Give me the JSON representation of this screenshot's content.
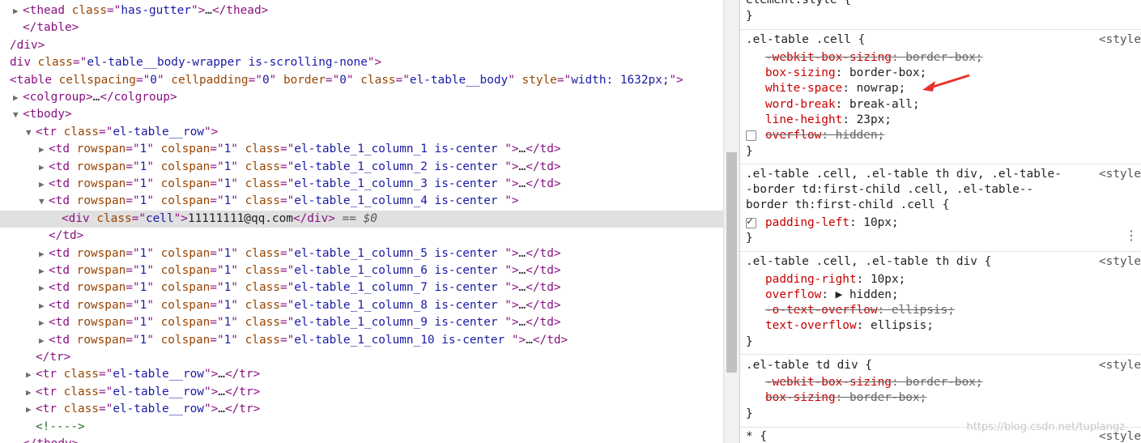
{
  "dom": {
    "lines": [
      {
        "indent": 1,
        "tri": "▶",
        "parts": [
          [
            "tag",
            "<"
          ],
          [
            "tag",
            "thead"
          ],
          [
            "tx",
            " "
          ],
          [
            "an",
            "class"
          ],
          [
            "tag",
            "=\""
          ],
          [
            "av",
            "has-gutter"
          ],
          [
            "tag",
            "\">"
          ],
          [
            "tx",
            "…"
          ],
          [
            "tag",
            "</thead>"
          ]
        ]
      },
      {
        "indent": 1,
        "tri": "",
        "parts": [
          [
            "tag",
            "</table>"
          ]
        ]
      },
      {
        "indent": 0,
        "tri": "",
        "parts": [
          [
            "tag",
            "/div>"
          ]
        ]
      },
      {
        "indent": 0,
        "tri": "",
        "parts": [
          [
            "tag",
            "div "
          ],
          [
            "an",
            "class"
          ],
          [
            "tag",
            "=\""
          ],
          [
            "av",
            "el-table__body-wrapper is-scrolling-none"
          ],
          [
            "tag",
            "\">"
          ]
        ]
      },
      {
        "indent": 0,
        "tri": "",
        "parts": [
          [
            "tag",
            "<table "
          ],
          [
            "an",
            "cellspacing"
          ],
          [
            "tag",
            "=\""
          ],
          [
            "av",
            "0"
          ],
          [
            "tag",
            "\" "
          ],
          [
            "an",
            "cellpadding"
          ],
          [
            "tag",
            "=\""
          ],
          [
            "av",
            "0"
          ],
          [
            "tag",
            "\" "
          ],
          [
            "an",
            "border"
          ],
          [
            "tag",
            "=\""
          ],
          [
            "av",
            "0"
          ],
          [
            "tag",
            "\" "
          ],
          [
            "an",
            "class"
          ],
          [
            "tag",
            "=\""
          ],
          [
            "av",
            "el-table__body"
          ],
          [
            "tag",
            "\" "
          ],
          [
            "an",
            "style"
          ],
          [
            "tag",
            "=\""
          ],
          [
            "av",
            "width: 1632px;"
          ],
          [
            "tag",
            "\">"
          ]
        ]
      },
      {
        "indent": 1,
        "tri": "▶",
        "parts": [
          [
            "tag",
            "<colgroup>"
          ],
          [
            "tx",
            "…"
          ],
          [
            "tag",
            "</colgroup>"
          ]
        ]
      },
      {
        "indent": 1,
        "tri": "▼",
        "parts": [
          [
            "tag",
            "<tbody>"
          ]
        ]
      },
      {
        "indent": 2,
        "tri": "▼",
        "parts": [
          [
            "tag",
            "<tr "
          ],
          [
            "an",
            "class"
          ],
          [
            "tag",
            "=\""
          ],
          [
            "av",
            "el-table__row"
          ],
          [
            "tag",
            "\">"
          ]
        ]
      },
      {
        "indent": 3,
        "tri": "▶",
        "parts": [
          [
            "tag",
            "<td "
          ],
          [
            "an",
            "rowspan"
          ],
          [
            "tag",
            "=\""
          ],
          [
            "av",
            "1"
          ],
          [
            "tag",
            "\" "
          ],
          [
            "an",
            "colspan"
          ],
          [
            "tag",
            "=\""
          ],
          [
            "av",
            "1"
          ],
          [
            "tag",
            "\" "
          ],
          [
            "an",
            "class"
          ],
          [
            "tag",
            "=\""
          ],
          [
            "av",
            "el-table_1_column_1 is-center "
          ],
          [
            "tag",
            "\">"
          ],
          [
            "tx",
            "…"
          ],
          [
            "tag",
            "</td>"
          ]
        ]
      },
      {
        "indent": 3,
        "tri": "▶",
        "parts": [
          [
            "tag",
            "<td "
          ],
          [
            "an",
            "rowspan"
          ],
          [
            "tag",
            "=\""
          ],
          [
            "av",
            "1"
          ],
          [
            "tag",
            "\" "
          ],
          [
            "an",
            "colspan"
          ],
          [
            "tag",
            "=\""
          ],
          [
            "av",
            "1"
          ],
          [
            "tag",
            "\" "
          ],
          [
            "an",
            "class"
          ],
          [
            "tag",
            "=\""
          ],
          [
            "av",
            "el-table_1_column_2 is-center "
          ],
          [
            "tag",
            "\">"
          ],
          [
            "tx",
            "…"
          ],
          [
            "tag",
            "</td>"
          ]
        ]
      },
      {
        "indent": 3,
        "tri": "▶",
        "parts": [
          [
            "tag",
            "<td "
          ],
          [
            "an",
            "rowspan"
          ],
          [
            "tag",
            "=\""
          ],
          [
            "av",
            "1"
          ],
          [
            "tag",
            "\" "
          ],
          [
            "an",
            "colspan"
          ],
          [
            "tag",
            "=\""
          ],
          [
            "av",
            "1"
          ],
          [
            "tag",
            "\" "
          ],
          [
            "an",
            "class"
          ],
          [
            "tag",
            "=\""
          ],
          [
            "av",
            "el-table_1_column_3 is-center "
          ],
          [
            "tag",
            "\">"
          ],
          [
            "tx",
            "…"
          ],
          [
            "tag",
            "</td>"
          ]
        ]
      },
      {
        "indent": 3,
        "tri": "▼",
        "parts": [
          [
            "tag",
            "<td "
          ],
          [
            "an",
            "rowspan"
          ],
          [
            "tag",
            "=\""
          ],
          [
            "av",
            "1"
          ],
          [
            "tag",
            "\" "
          ],
          [
            "an",
            "colspan"
          ],
          [
            "tag",
            "=\""
          ],
          [
            "av",
            "1"
          ],
          [
            "tag",
            "\" "
          ],
          [
            "an",
            "class"
          ],
          [
            "tag",
            "=\""
          ],
          [
            "av",
            "el-table_1_column_4 is-center "
          ],
          [
            "tag",
            "\">"
          ]
        ]
      },
      {
        "indent": 4,
        "tri": "",
        "sel": true,
        "parts": [
          [
            "tag",
            "<div "
          ],
          [
            "an",
            "class"
          ],
          [
            "tag",
            "=\""
          ],
          [
            "av",
            "cell"
          ],
          [
            "tag",
            "\">"
          ],
          [
            "tx",
            "11111111@qq.com"
          ],
          [
            "tag",
            "</div>"
          ],
          [
            "eq",
            " == $0"
          ]
        ]
      },
      {
        "indent": 3,
        "tri": "",
        "parts": [
          [
            "tag",
            "</td>"
          ]
        ]
      },
      {
        "indent": 3,
        "tri": "▶",
        "parts": [
          [
            "tag",
            "<td "
          ],
          [
            "an",
            "rowspan"
          ],
          [
            "tag",
            "=\""
          ],
          [
            "av",
            "1"
          ],
          [
            "tag",
            "\" "
          ],
          [
            "an",
            "colspan"
          ],
          [
            "tag",
            "=\""
          ],
          [
            "av",
            "1"
          ],
          [
            "tag",
            "\" "
          ],
          [
            "an",
            "class"
          ],
          [
            "tag",
            "=\""
          ],
          [
            "av",
            "el-table_1_column_5 is-center "
          ],
          [
            "tag",
            "\">"
          ],
          [
            "tx",
            "…"
          ],
          [
            "tag",
            "</td>"
          ]
        ]
      },
      {
        "indent": 3,
        "tri": "▶",
        "parts": [
          [
            "tag",
            "<td "
          ],
          [
            "an",
            "rowspan"
          ],
          [
            "tag",
            "=\""
          ],
          [
            "av",
            "1"
          ],
          [
            "tag",
            "\" "
          ],
          [
            "an",
            "colspan"
          ],
          [
            "tag",
            "=\""
          ],
          [
            "av",
            "1"
          ],
          [
            "tag",
            "\" "
          ],
          [
            "an",
            "class"
          ],
          [
            "tag",
            "=\""
          ],
          [
            "av",
            "el-table_1_column_6 is-center "
          ],
          [
            "tag",
            "\">"
          ],
          [
            "tx",
            "…"
          ],
          [
            "tag",
            "</td>"
          ]
        ]
      },
      {
        "indent": 3,
        "tri": "▶",
        "parts": [
          [
            "tag",
            "<td "
          ],
          [
            "an",
            "rowspan"
          ],
          [
            "tag",
            "=\""
          ],
          [
            "av",
            "1"
          ],
          [
            "tag",
            "\" "
          ],
          [
            "an",
            "colspan"
          ],
          [
            "tag",
            "=\""
          ],
          [
            "av",
            "1"
          ],
          [
            "tag",
            "\" "
          ],
          [
            "an",
            "class"
          ],
          [
            "tag",
            "=\""
          ],
          [
            "av",
            "el-table_1_column_7 is-center "
          ],
          [
            "tag",
            "\">"
          ],
          [
            "tx",
            "…"
          ],
          [
            "tag",
            "</td>"
          ]
        ]
      },
      {
        "indent": 3,
        "tri": "▶",
        "parts": [
          [
            "tag",
            "<td "
          ],
          [
            "an",
            "rowspan"
          ],
          [
            "tag",
            "=\""
          ],
          [
            "av",
            "1"
          ],
          [
            "tag",
            "\" "
          ],
          [
            "an",
            "colspan"
          ],
          [
            "tag",
            "=\""
          ],
          [
            "av",
            "1"
          ],
          [
            "tag",
            "\" "
          ],
          [
            "an",
            "class"
          ],
          [
            "tag",
            "=\""
          ],
          [
            "av",
            "el-table_1_column_8 is-center "
          ],
          [
            "tag",
            "\">"
          ],
          [
            "tx",
            "…"
          ],
          [
            "tag",
            "</td>"
          ]
        ]
      },
      {
        "indent": 3,
        "tri": "▶",
        "parts": [
          [
            "tag",
            "<td "
          ],
          [
            "an",
            "rowspan"
          ],
          [
            "tag",
            "=\""
          ],
          [
            "av",
            "1"
          ],
          [
            "tag",
            "\" "
          ],
          [
            "an",
            "colspan"
          ],
          [
            "tag",
            "=\""
          ],
          [
            "av",
            "1"
          ],
          [
            "tag",
            "\" "
          ],
          [
            "an",
            "class"
          ],
          [
            "tag",
            "=\""
          ],
          [
            "av",
            "el-table_1_column_9 is-center "
          ],
          [
            "tag",
            "\">"
          ],
          [
            "tx",
            "…"
          ],
          [
            "tag",
            "</td>"
          ]
        ]
      },
      {
        "indent": 3,
        "tri": "▶",
        "parts": [
          [
            "tag",
            "<td "
          ],
          [
            "an",
            "rowspan"
          ],
          [
            "tag",
            "=\""
          ],
          [
            "av",
            "1"
          ],
          [
            "tag",
            "\" "
          ],
          [
            "an",
            "colspan"
          ],
          [
            "tag",
            "=\""
          ],
          [
            "av",
            "1"
          ],
          [
            "tag",
            "\" "
          ],
          [
            "an",
            "class"
          ],
          [
            "tag",
            "=\""
          ],
          [
            "av",
            "el-table_1_column_10 is-center "
          ],
          [
            "tag",
            "\">"
          ],
          [
            "tx",
            "…"
          ],
          [
            "tag",
            "</td>"
          ]
        ]
      },
      {
        "indent": 2,
        "tri": "",
        "parts": [
          [
            "tag",
            "</tr>"
          ]
        ]
      },
      {
        "indent": 2,
        "tri": "▶",
        "parts": [
          [
            "tag",
            "<tr "
          ],
          [
            "an",
            "class"
          ],
          [
            "tag",
            "=\""
          ],
          [
            "av",
            "el-table__row"
          ],
          [
            "tag",
            "\">"
          ],
          [
            "tx",
            "…"
          ],
          [
            "tag",
            "</tr>"
          ]
        ]
      },
      {
        "indent": 2,
        "tri": "▶",
        "parts": [
          [
            "tag",
            "<tr "
          ],
          [
            "an",
            "class"
          ],
          [
            "tag",
            "=\""
          ],
          [
            "av",
            "el-table__row"
          ],
          [
            "tag",
            "\">"
          ],
          [
            "tx",
            "…"
          ],
          [
            "tag",
            "</tr>"
          ]
        ]
      },
      {
        "indent": 2,
        "tri": "▶",
        "parts": [
          [
            "tag",
            "<tr "
          ],
          [
            "an",
            "class"
          ],
          [
            "tag",
            "=\""
          ],
          [
            "av",
            "el-table__row"
          ],
          [
            "tag",
            "\">"
          ],
          [
            "tx",
            "…"
          ],
          [
            "tag",
            "</tr>"
          ]
        ]
      },
      {
        "indent": 2,
        "tri": "",
        "parts": [
          [
            "cm",
            "<!---->"
          ]
        ]
      },
      {
        "indent": 1,
        "tri": "",
        "parts": [
          [
            "tag",
            "</tbody>"
          ]
        ]
      }
    ]
  },
  "styles": {
    "top_selector": "element.style {",
    "rules": [
      {
        "selector": ".el-table .cell {",
        "source": "<style",
        "props": [
          {
            "name": "-webkit-box-sizing",
            "value": "border-box;",
            "struck": true
          },
          {
            "name": "box-sizing",
            "value": "border-box;"
          },
          {
            "name": "white-space",
            "value": "nowrap;"
          },
          {
            "name": "word-break",
            "value": "break-all;"
          },
          {
            "name": "line-height",
            "value": "23px;"
          },
          {
            "name": "overflow",
            "value": "hidden;",
            "struck": true,
            "checkbox": "off"
          }
        ]
      },
      {
        "selector_lines": [
          ".el-table .cell, .el-table th div, .el-table-",
          "-border td:first-child .cell, .el-table--",
          "border th:first-child .cell {"
        ],
        "source": "<style",
        "props": [
          {
            "name": "padding-left",
            "value": "10px;",
            "checkbox": "on"
          }
        ]
      },
      {
        "selector": ".el-table .cell, .el-table th div {",
        "source": "<style",
        "props": [
          {
            "name": "padding-right",
            "value": "10px;"
          },
          {
            "name": "overflow",
            "value": "▶ hidden;"
          },
          {
            "name": "-o-text-overflow",
            "value": "ellipsis;",
            "struck": true
          },
          {
            "name": "text-overflow",
            "value": "ellipsis;"
          }
        ]
      },
      {
        "selector": ".el-table td div {",
        "source": "<style",
        "props": [
          {
            "name": "-webkit-box-sizing",
            "value": "border-box;",
            "struck": true
          },
          {
            "name": "box-sizing",
            "value": "border-box;",
            "struck": true
          }
        ]
      },
      {
        "selector": "* {",
        "source": "<style",
        "props": []
      }
    ],
    "close_brace": "}",
    "more_icon": "⋮",
    "watermark": "https://blog.csdn.net/tuplangz"
  },
  "colors": {
    "annotation_arrow": "#e8322b"
  }
}
